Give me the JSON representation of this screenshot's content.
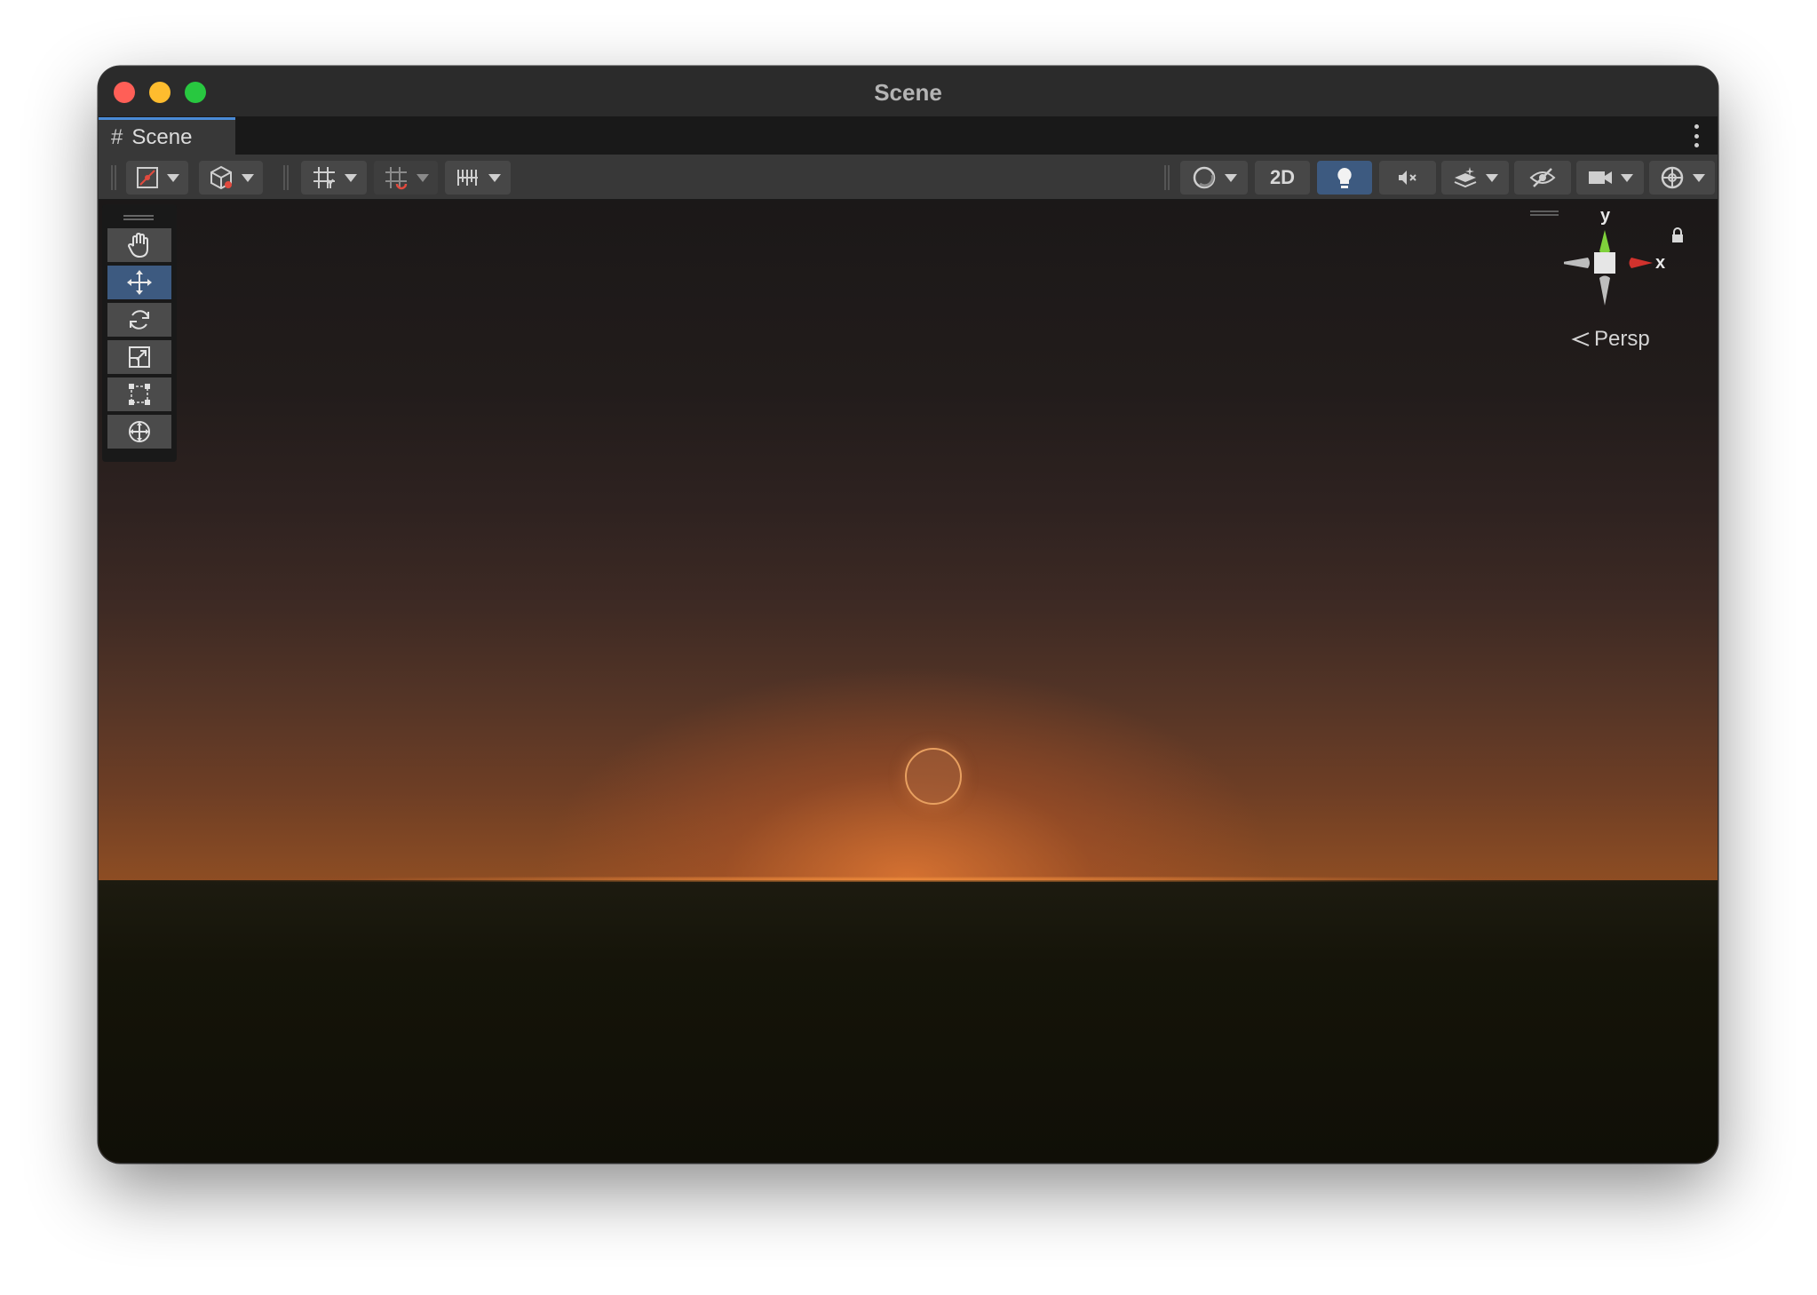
{
  "window": {
    "title": "Scene"
  },
  "tabs": [
    {
      "label": "Scene",
      "icon": "grid-hash-icon",
      "active": true
    }
  ],
  "toolbar": {
    "left": [
      {
        "name": "draw-mode-button",
        "icon": "draw-gizmo-icon",
        "dropdown": true
      },
      {
        "name": "scene-view-mode-button",
        "icon": "cube-icon",
        "dropdown": true
      },
      {
        "name": "grid-visibility-button",
        "icon": "grid-axis-icon",
        "dropdown": true
      },
      {
        "name": "grid-snapping-button",
        "icon": "grid-snap-icon",
        "dropdown": true
      },
      {
        "name": "increment-snap-button",
        "icon": "ruler-icon",
        "dropdown": true
      }
    ],
    "right": [
      {
        "name": "shading-mode-button",
        "icon": "sphere-shading-icon",
        "dropdown": true
      },
      {
        "name": "toggle-2d-button",
        "label": "2D"
      },
      {
        "name": "lighting-toggle-button",
        "icon": "lightbulb-icon",
        "active": true
      },
      {
        "name": "audio-toggle-button",
        "icon": "audio-mute-icon"
      },
      {
        "name": "effects-button",
        "icon": "effects-layers-icon",
        "dropdown": true
      },
      {
        "name": "hidden-objects-toggle-button",
        "icon": "eye-slash-icon"
      },
      {
        "name": "camera-settings-button",
        "icon": "camera-icon",
        "dropdown": true
      },
      {
        "name": "gizmos-button",
        "icon": "gizmo-globe-icon",
        "dropdown": true
      }
    ],
    "toggle_2d_label": "2D"
  },
  "tools": [
    {
      "name": "hand-tool",
      "icon": "hand-icon",
      "active": false
    },
    {
      "name": "move-tool",
      "icon": "move-arrows-icon",
      "active": true
    },
    {
      "name": "rotate-tool",
      "icon": "rotate-icon",
      "active": false
    },
    {
      "name": "scale-tool",
      "icon": "scale-icon",
      "active": false
    },
    {
      "name": "rect-tool",
      "icon": "rect-transform-icon",
      "active": false
    },
    {
      "name": "transform-tool",
      "icon": "transform-icon",
      "active": false
    }
  ],
  "gizmo": {
    "y_label": "y",
    "x_label": "x",
    "projection_label": "Persp"
  },
  "colors": {
    "accent": "#3d5a80",
    "x_axis": "#d2322d",
    "y_axis": "#7fd13b",
    "sun": "#e8a060"
  }
}
